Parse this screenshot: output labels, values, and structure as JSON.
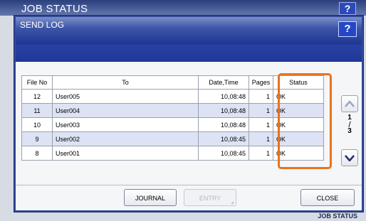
{
  "background": {
    "title": "JOB STATUS",
    "help_label": "?",
    "status_tab_label": "JOB STATUS"
  },
  "dialog": {
    "title": "SEND LOG",
    "help_label": "?"
  },
  "table": {
    "headers": [
      "File No",
      "To",
      "Date,Time",
      "Pages",
      "Status"
    ],
    "rows": [
      {
        "file_no": "12",
        "to": "User005",
        "datetime": "10,08:48",
        "pages": "1",
        "status": "OK"
      },
      {
        "file_no": "11",
        "to": "User004",
        "datetime": "10,08:48",
        "pages": "1",
        "status": "OK"
      },
      {
        "file_no": "10",
        "to": "User003",
        "datetime": "10,08:48",
        "pages": "1",
        "status": "OK"
      },
      {
        "file_no": "9",
        "to": "User002",
        "datetime": "10,08:45",
        "pages": "1",
        "status": "OK"
      },
      {
        "file_no": "8",
        "to": "User001",
        "datetime": "10,08:45",
        "pages": "1",
        "status": "OK"
      }
    ]
  },
  "pagination": {
    "current_page": "1",
    "total_pages": "3"
  },
  "buttons": {
    "journal": "JOURNAL",
    "entry": "ENTRY",
    "close": "CLOSE"
  },
  "colors": {
    "highlight_frame": "#e8731c",
    "titlebar": "#1e3694",
    "alt_row": "#dde3f4"
  }
}
